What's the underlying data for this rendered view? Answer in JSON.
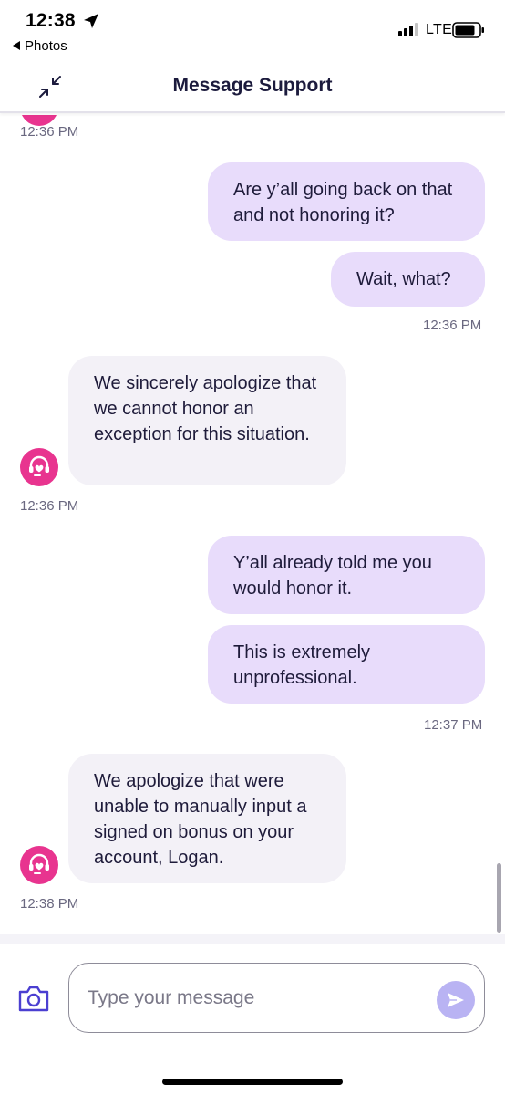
{
  "status_bar": {
    "time": "12:38",
    "back_app": "Photos",
    "network": "LTE"
  },
  "header": {
    "title": "Message Support"
  },
  "messages": [
    {
      "kind": "timestamp",
      "text": "12:36 PM"
    },
    {
      "kind": "outgoing",
      "text": "Are y’all going back on that and not honoring it?"
    },
    {
      "kind": "outgoing",
      "text": "Wait, what?"
    },
    {
      "kind": "timestamp",
      "text": "12:36 PM"
    },
    {
      "kind": "incoming",
      "text": "We sincerely apologize that we cannot honor an exception for this situation."
    },
    {
      "kind": "timestamp",
      "text": "12:36 PM"
    },
    {
      "kind": "outgoing",
      "text": "Y’all already told me you would honor it."
    },
    {
      "kind": "outgoing",
      "text": "This is extremely unprofessional."
    },
    {
      "kind": "timestamp",
      "text": "12:37 PM"
    },
    {
      "kind": "incoming",
      "text": "We apologize that were unable to manually input a signed on bonus on your account, Logan."
    },
    {
      "kind": "timestamp",
      "text": "12:38 PM"
    }
  ],
  "composer": {
    "placeholder": "Type your message",
    "camera_icon": "camera-icon",
    "send_icon": "send-icon"
  },
  "colors": {
    "outgoing_bubble": "#e8dcfb",
    "incoming_bubble": "#f3f1f7",
    "agent_avatar": "#e8348f",
    "send_button": "#b9b3f3"
  }
}
